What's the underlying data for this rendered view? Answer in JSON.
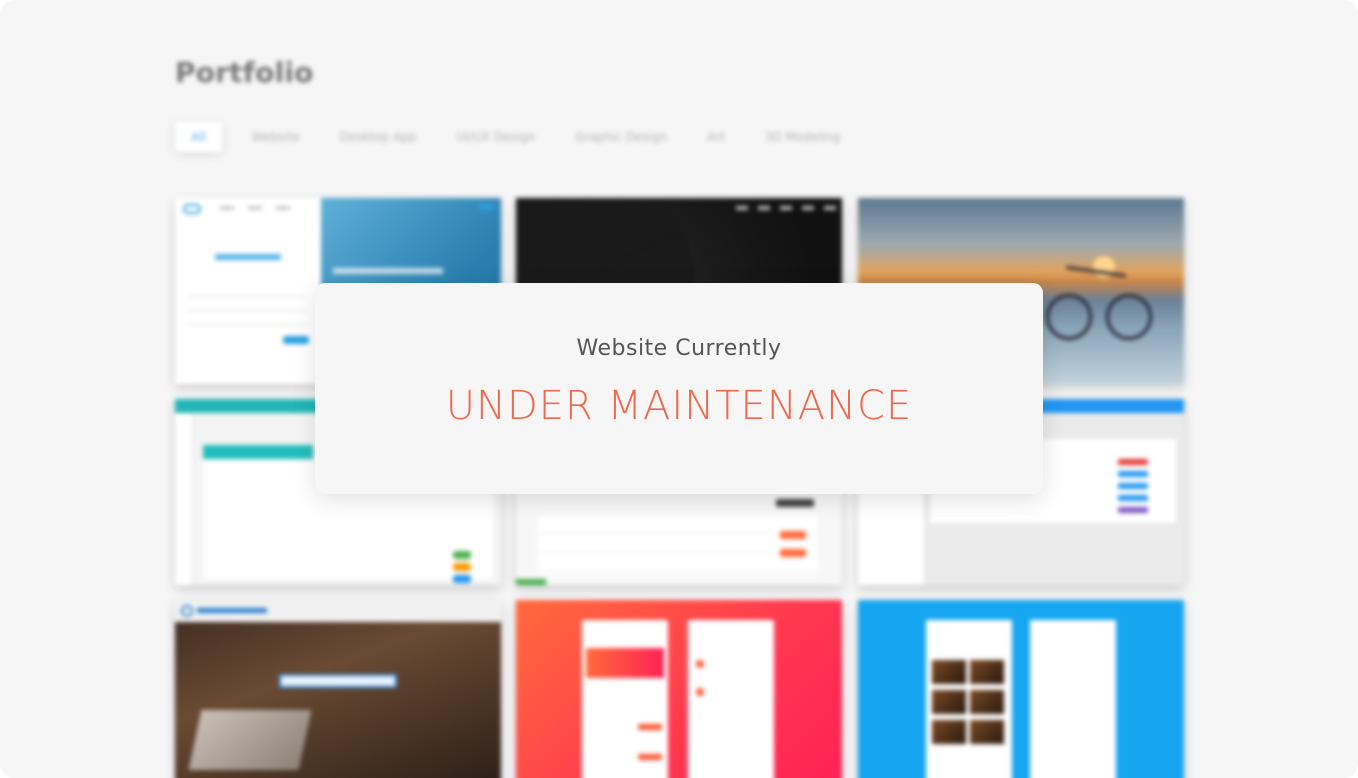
{
  "portfolio": {
    "title": "Portfolio",
    "filters": [
      "All",
      "Website",
      "Desktop App",
      "UI/UX Design",
      "Graphic Design",
      "Art",
      "3D Modeling"
    ],
    "active_filter": "All"
  },
  "maintenance": {
    "subtitle": "Website Currently",
    "headline": "UNDER MAINTENANCE"
  },
  "colors": {
    "accent": "#ee6a4e",
    "filter_active": "#5aaaf0"
  }
}
